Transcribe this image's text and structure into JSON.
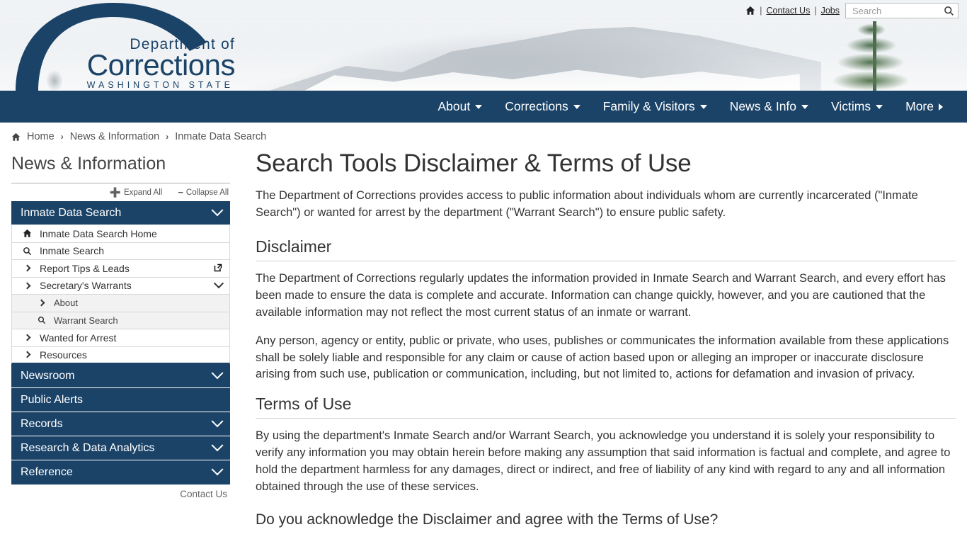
{
  "utility": {
    "home_icon": "home-icon",
    "separator": "|",
    "contact_us": "Contact Us",
    "jobs": "Jobs",
    "search_placeholder": "Search",
    "search_value": "",
    "search_icon": "magnifier-icon"
  },
  "logo": {
    "line1": "Department of",
    "line2": "Corrections",
    "line3": "WASHINGTON STATE",
    "color": "#1b4368"
  },
  "mainnav": {
    "items": [
      {
        "label": "About",
        "caret": "down"
      },
      {
        "label": "Corrections",
        "caret": "down"
      },
      {
        "label": "Family & Visitors",
        "caret": "down"
      },
      {
        "label": "News & Info",
        "caret": "down"
      },
      {
        "label": "Victims",
        "caret": "down"
      },
      {
        "label": "More",
        "caret": "right"
      }
    ],
    "background": "#1b4368"
  },
  "breadcrumb": {
    "home": "Home",
    "level2": "News & Information",
    "level3": "Inmate Data Search",
    "separator": "›"
  },
  "sidebar": {
    "title": "News & Information",
    "expand_all": "Expand All",
    "collapse_all": "Collapse All",
    "expand_icon": "plus-icon",
    "collapse_icon": "minus-icon",
    "active_section": {
      "label": "Inmate Data Search",
      "chevron": "chevron-down-icon"
    },
    "items": [
      {
        "label": "Inmate Data Search Home",
        "icon": "home-icon",
        "sub": false,
        "chevron": false,
        "external": false
      },
      {
        "label": "Inmate Search",
        "icon": "magnifier-icon",
        "sub": false,
        "chevron": false,
        "external": false
      },
      {
        "label": "Report Tips & Leads",
        "icon": "chevron-right-icon",
        "sub": false,
        "chevron": false,
        "external": true
      },
      {
        "label": "Secretary's Warrants",
        "icon": "chevron-right-icon",
        "sub": false,
        "chevron": true,
        "external": false
      },
      {
        "label": "About",
        "icon": "chevron-right-icon",
        "sub": true,
        "chevron": false,
        "external": false
      },
      {
        "label": "Warrant Search",
        "icon": "magnifier-icon",
        "sub": true,
        "chevron": false,
        "external": false
      },
      {
        "label": "Wanted for Arrest",
        "icon": "chevron-right-icon",
        "sub": false,
        "chevron": false,
        "external": false
      },
      {
        "label": "Resources",
        "icon": "chevron-right-icon",
        "sub": false,
        "chevron": false,
        "external": false
      }
    ],
    "sections": [
      {
        "label": "Newsroom",
        "chevron": true
      },
      {
        "label": "Public Alerts",
        "chevron": false
      },
      {
        "label": "Records",
        "chevron": true
      },
      {
        "label": "Research & Data Analytics",
        "chevron": true
      },
      {
        "label": "Reference",
        "chevron": true
      }
    ],
    "contact_us": "Contact Us"
  },
  "main": {
    "title": "Search Tools Disclaimer & Terms of Use",
    "lead": "The Department of Corrections provides access to public information about individuals whom are currently incarcerated (\"Inmate Search\") or wanted for arrest by the department (\"Warrant Search\") to ensure public safety.",
    "disclaimer_heading": "Disclaimer",
    "disclaimer_p1": "The Department of Corrections regularly updates the information provided in Inmate Search and Warrant Search, and every effort has been made to ensure the data is complete and accurate. Information can change quickly, however, and you are cautioned that the available information may not reflect the most current status of an inmate or warrant.",
    "disclaimer_p2": "Any person, agency or entity, public or private, who uses, publishes or communicates the information available from these applications shall be solely liable and responsible for any claim or cause of action based upon or alleging an improper or inaccurate disclosure arising from such use, publication or communication, including, but not limited to, actions for defamation and invasion of privacy.",
    "terms_heading": "Terms of Use",
    "terms_p1": "By using the department's Inmate Search and/or Warrant Search, you acknowledge you understand it is solely your responsibility to verify any information you may obtain herein before making any assumption that said information is factual and complete, and agree to hold the department harmless for any damages, direct or indirect, and free of liability of any kind with regard to any and all information obtained through the use of these services.",
    "acknowledge_question": "Do you acknowledge the Disclaimer and agree with the Terms of Use?"
  }
}
